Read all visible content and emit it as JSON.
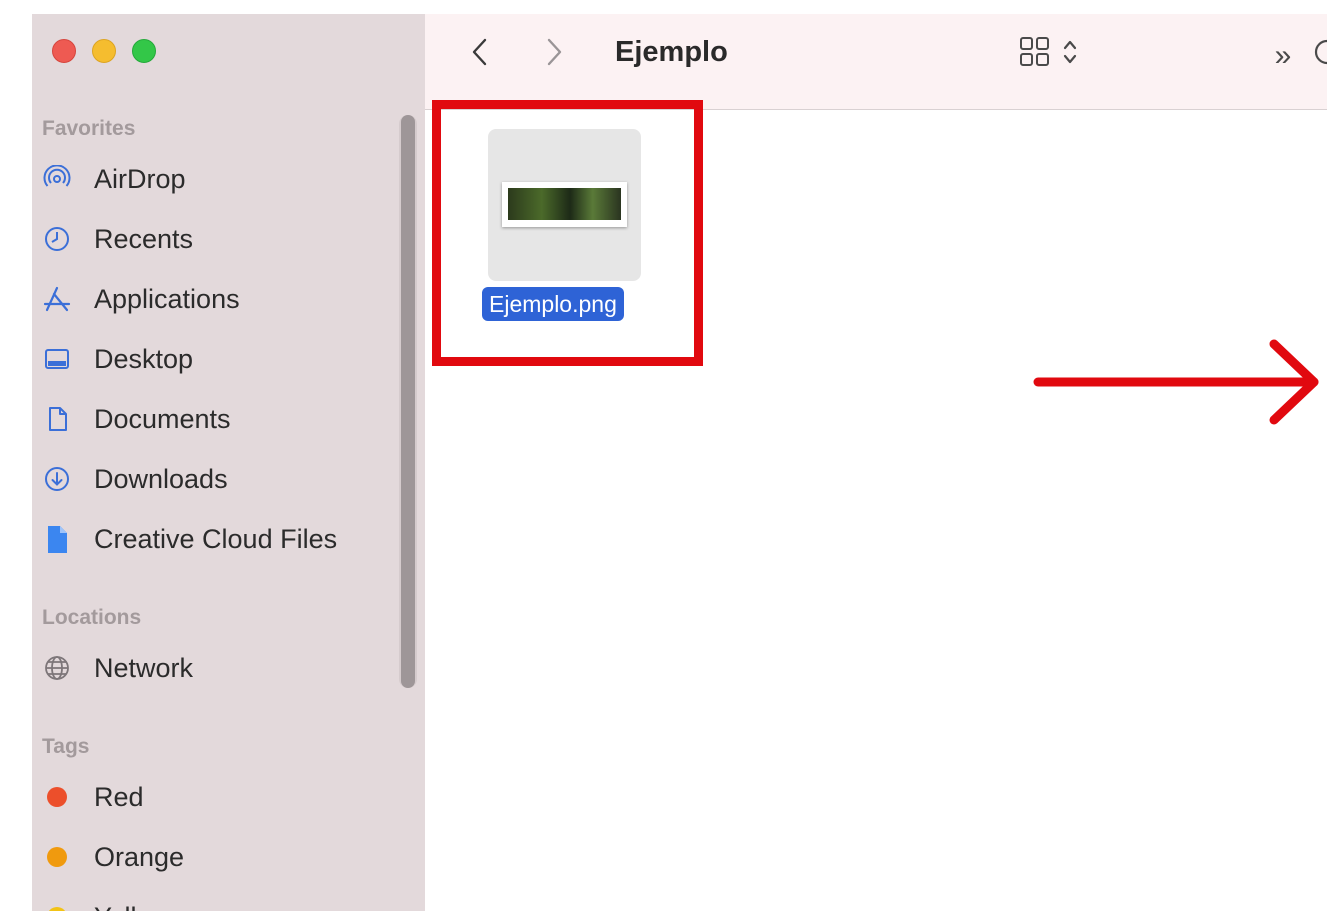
{
  "window": {
    "title": "Ejemplo",
    "accent_color": "#2e63d6",
    "annotation_color": "#e1090f"
  },
  "toolbar": {
    "back_icon": "chevron-left-icon",
    "forward_icon": "chevron-right-icon",
    "view_icon": "icon-grid-icon",
    "more_icon": "double-chevron-right-icon",
    "more_label": "»"
  },
  "sidebar": {
    "favorites_title": "Favorites",
    "favorites": [
      {
        "label": "AirDrop",
        "icon": "airdrop-icon"
      },
      {
        "label": "Recents",
        "icon": "clock-icon"
      },
      {
        "label": "Applications",
        "icon": "applications-icon"
      },
      {
        "label": "Desktop",
        "icon": "desktop-icon"
      },
      {
        "label": "Documents",
        "icon": "document-icon"
      },
      {
        "label": "Downloads",
        "icon": "download-icon"
      },
      {
        "label": "Creative Cloud Files",
        "icon": "cloud-file-icon"
      }
    ],
    "locations_title": "Locations",
    "locations": [
      {
        "label": "Network",
        "icon": "globe-icon"
      }
    ],
    "tags_title": "Tags",
    "tags": [
      {
        "label": "Red",
        "color": "#ec4f2b"
      },
      {
        "label": "Orange",
        "color": "#f09a0e"
      },
      {
        "label": "Yellow",
        "color": "#f2c316"
      }
    ]
  },
  "files": [
    {
      "name": "Ejemplo.png",
      "selected": true
    }
  ]
}
